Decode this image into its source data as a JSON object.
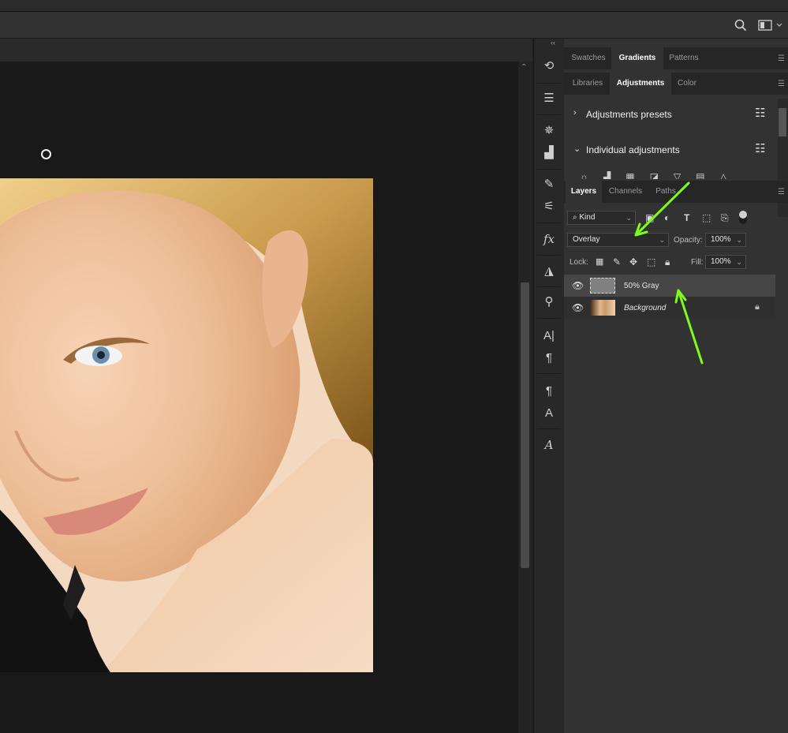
{
  "window": {
    "collapse_glyph": "‹‹",
    "options_icons": [
      "search-icon",
      "workspace-icon"
    ]
  },
  "panels": {
    "top_tabs": [
      {
        "label": "Swatches",
        "active": false
      },
      {
        "label": "Gradients",
        "active": true
      },
      {
        "label": "Patterns",
        "active": false
      }
    ],
    "adj_tabs": [
      {
        "label": "Libraries",
        "active": false
      },
      {
        "label": "Adjustments",
        "active": true
      },
      {
        "label": "Color",
        "active": false
      }
    ],
    "adjustments": {
      "presets_label": "Adjustments presets",
      "individual_label": "Individual adjustments"
    },
    "layer_tabs": [
      {
        "label": "Layers",
        "active": true
      },
      {
        "label": "Channels",
        "active": false
      },
      {
        "label": "Paths",
        "active": false
      }
    ]
  },
  "layers_panel": {
    "filter_kind": "Kind",
    "blend_mode": "Overlay",
    "opacity_label": "Opacity:",
    "opacity_value": "100%",
    "lock_label": "Lock:",
    "fill_label": "Fill:",
    "fill_value": "100%",
    "layers": [
      {
        "name": "50% Gray",
        "selected": true,
        "visible": true,
        "locked": false
      },
      {
        "name": "Background",
        "selected": false,
        "visible": true,
        "locked": true
      }
    ]
  },
  "annotations": {
    "arrow_color": "#7cfc1a"
  },
  "colors": {
    "panel_bg": "#323232",
    "canvas_bg": "#191919",
    "selection": "#464646"
  }
}
